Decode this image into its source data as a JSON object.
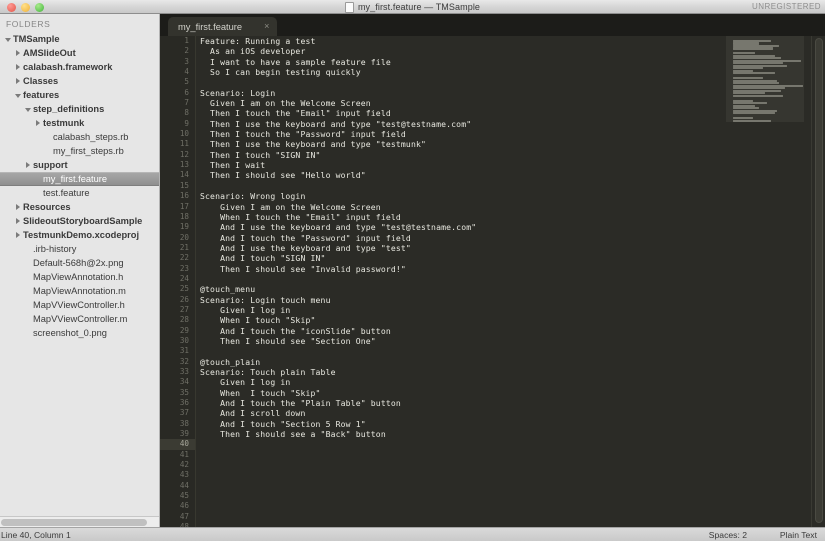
{
  "window": {
    "title": "my_first.feature — TMSample",
    "license_badge": "UNREGISTERED",
    "traffic_lights": [
      "close-button",
      "minimize-button",
      "zoom-button"
    ]
  },
  "sidebar": {
    "header": "FOLDERS",
    "items": [
      {
        "label": "TMSample",
        "indent": 0,
        "arrow": "open",
        "bold": true,
        "selected": false
      },
      {
        "label": "AMSlideOut",
        "indent": 1,
        "arrow": "closed",
        "bold": true,
        "selected": false
      },
      {
        "label": "calabash.framework",
        "indent": 1,
        "arrow": "closed",
        "bold": true,
        "selected": false
      },
      {
        "label": "Classes",
        "indent": 1,
        "arrow": "closed",
        "bold": true,
        "selected": false
      },
      {
        "label": "features",
        "indent": 1,
        "arrow": "open",
        "bold": true,
        "selected": false
      },
      {
        "label": "step_definitions",
        "indent": 2,
        "arrow": "open",
        "bold": true,
        "selected": false
      },
      {
        "label": "testmunk",
        "indent": 3,
        "arrow": "closed",
        "bold": true,
        "selected": false
      },
      {
        "label": "calabash_steps.rb",
        "indent": 4,
        "arrow": "none",
        "bold": false,
        "selected": false
      },
      {
        "label": "my_first_steps.rb",
        "indent": 4,
        "arrow": "none",
        "bold": false,
        "selected": false
      },
      {
        "label": "support",
        "indent": 2,
        "arrow": "closed",
        "bold": true,
        "selected": false
      },
      {
        "label": "my_first.feature",
        "indent": 3,
        "arrow": "none",
        "bold": false,
        "selected": true
      },
      {
        "label": "test.feature",
        "indent": 3,
        "arrow": "none",
        "bold": false,
        "selected": false
      },
      {
        "label": "Resources",
        "indent": 1,
        "arrow": "closed",
        "bold": true,
        "selected": false
      },
      {
        "label": "SlideoutStoryboardSample",
        "indent": 1,
        "arrow": "closed",
        "bold": true,
        "selected": false
      },
      {
        "label": "TestmunkDemo.xcodeproj",
        "indent": 1,
        "arrow": "closed",
        "bold": true,
        "selected": false
      },
      {
        "label": ".irb-history",
        "indent": 2,
        "arrow": "none",
        "bold": false,
        "selected": false
      },
      {
        "label": "Default-568h@2x.png",
        "indent": 2,
        "arrow": "none",
        "bold": false,
        "selected": false
      },
      {
        "label": "MapViewAnnotation.h",
        "indent": 2,
        "arrow": "none",
        "bold": false,
        "selected": false
      },
      {
        "label": "MapViewAnnotation.m",
        "indent": 2,
        "arrow": "none",
        "bold": false,
        "selected": false
      },
      {
        "label": "MapVViewController.h",
        "indent": 2,
        "arrow": "none",
        "bold": false,
        "selected": false
      },
      {
        "label": "MapVViewController.m",
        "indent": 2,
        "arrow": "none",
        "bold": false,
        "selected": false
      },
      {
        "label": "screenshot_0.png",
        "indent": 2,
        "arrow": "none",
        "bold": false,
        "selected": false
      }
    ]
  },
  "tabs": [
    {
      "label": "my_first.feature",
      "close": "×",
      "active": true
    }
  ],
  "editor": {
    "active_line": 40,
    "total_lines": 48,
    "lines": [
      "Feature: Running a test",
      "  As an iOS developer",
      "  I want to have a sample feature file",
      "  So I can begin testing quickly",
      "",
      "Scenario: Login",
      "  Given I am on the Welcome Screen",
      "  Then I touch the \"Email\" input field",
      "  Then I use the keyboard and type \"test@testname.com\"",
      "  Then I touch the \"Password\" input field",
      "  Then I use the keyboard and type \"testmunk\"",
      "  Then I touch \"SIGN IN\"",
      "  Then I wait",
      "  Then I should see \"Hello world\"",
      "",
      "Scenario: Wrong login",
      "    Given I am on the Welcome Screen",
      "    When I touch the \"Email\" input field",
      "    And I use the keyboard and type \"test@testname.com\"",
      "    And I touch the \"Password\" input field",
      "    And I use the keyboard and type \"test\"",
      "    And I touch \"SIGN IN\"",
      "    Then I should see \"Invalid password!\"",
      "",
      "@touch_menu",
      "Scenario: Login touch menu",
      "    Given I log in",
      "    When I touch \"Skip\"",
      "    And I touch the \"iconSlide\" button",
      "    Then I should see \"Section One\"",
      "",
      "@touch_plain",
      "Scenario: Touch plain Table",
      "    Given I log in",
      "    When  I touch \"Skip\"",
      "    And I touch the \"Plain Table\" button",
      "    And I scroll down",
      "    And I touch \"Section 5 Row 1\"",
      "    Then I should see a \"Back\" button",
      "",
      "",
      "",
      "",
      "",
      "",
      "",
      "",
      ""
    ]
  },
  "minimap": {
    "widths": [
      38,
      26,
      46,
      40,
      0,
      22,
      42,
      48,
      68,
      50,
      54,
      30,
      20,
      42,
      0,
      30,
      44,
      46,
      70,
      52,
      48,
      32,
      50,
      0,
      20,
      34,
      22,
      26,
      44,
      42,
      0,
      20,
      38,
      22,
      28,
      48,
      30,
      42,
      48,
      0
    ]
  },
  "statusbar": {
    "position": "Line 40, Column 1",
    "indentation": "Spaces: 2",
    "syntax": "Plain Text"
  }
}
